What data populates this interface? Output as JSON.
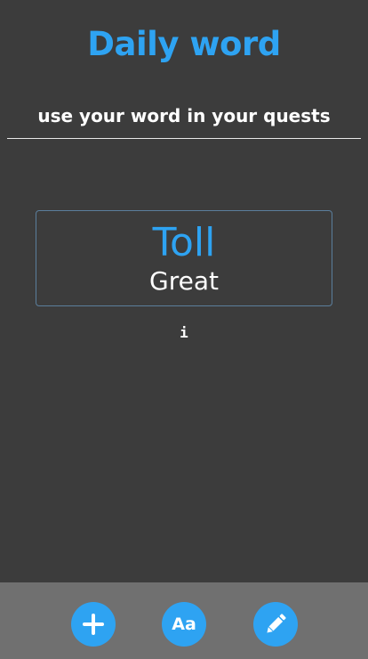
{
  "header": {
    "title": "Daily word",
    "subtitle": "use your word in your quests"
  },
  "word_card": {
    "word": "Toll",
    "meaning": "Great"
  },
  "info": {
    "label": "i"
  },
  "bottom_bar": {
    "add_icon": "plus-icon",
    "font_label": "Aa",
    "font_icon": "font-size-icon",
    "edit_icon": "pencil-icon"
  },
  "colors": {
    "background": "#3c3c3c",
    "accent": "#2ea3f2",
    "bottom_bar": "#707070",
    "card_border": "#5b7e9c"
  }
}
